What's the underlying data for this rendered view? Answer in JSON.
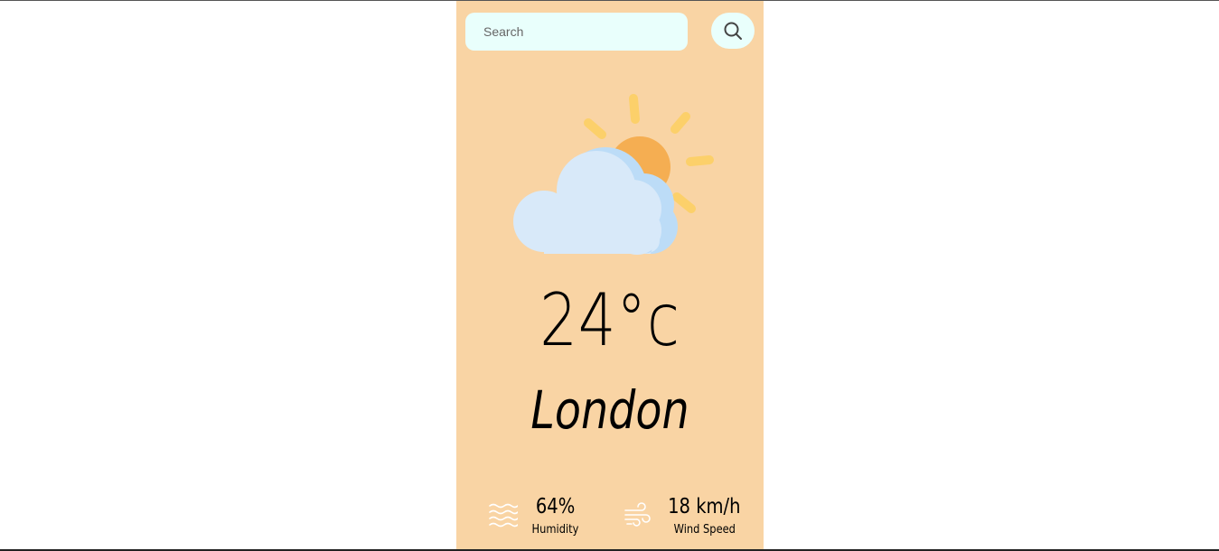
{
  "search": {
    "placeholder": "Search",
    "button_icon": "search-icon"
  },
  "weather": {
    "condition_icon": "partly-cloudy-icon",
    "temperature": "24°c",
    "city": "London"
  },
  "stats": {
    "humidity": {
      "icon": "humidity-icon",
      "value": "64%",
      "label": "Humidity"
    },
    "wind": {
      "icon": "wind-icon",
      "value": "18 km/h",
      "label": "Wind Speed"
    }
  },
  "colors": {
    "card_background": "#f9d4a4",
    "input_background": "#e9fffc",
    "sun": "#f5ae52",
    "sun_rays": "#fcd06a",
    "cloud": "#d8e9f9",
    "cloud_shade": "#bcdcf7"
  }
}
